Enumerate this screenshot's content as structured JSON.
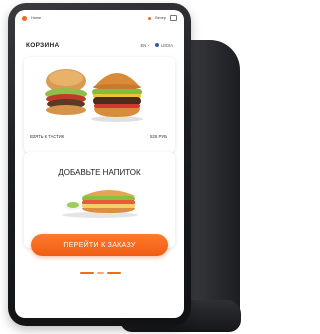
{
  "status": {
    "brand": "Home",
    "right_text": "Вечер"
  },
  "header": {
    "title": "КОРЗИНА",
    "lang": "EN",
    "account": "LEDIA"
  },
  "card1": {
    "label": "ВЗЯТЬ К ТАСТИК",
    "price": "525 РУБ"
  },
  "card2": {
    "title": "ДОБАВЬТЕ НАПИТОК"
  },
  "cta": {
    "label": "ПЕРЕЙТИ К ЗАКАЗУ"
  },
  "colors": {
    "accent": "#f26a1b",
    "bezel": "#1b1c1e",
    "account_dot": "#3d5aa8"
  }
}
